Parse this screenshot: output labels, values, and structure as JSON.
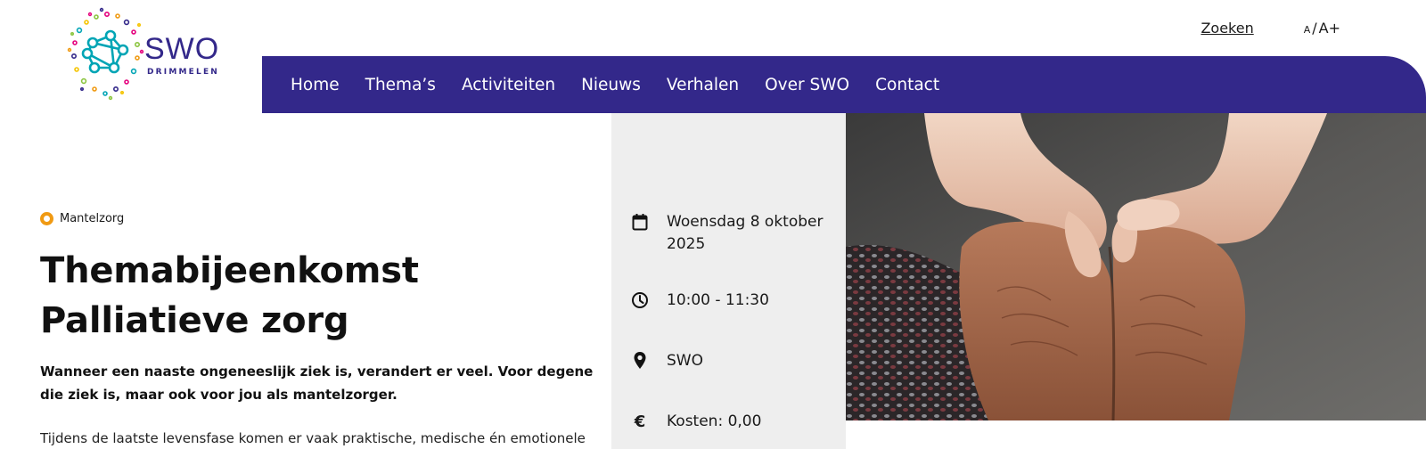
{
  "brand": {
    "name": "SWO",
    "subtitle": "DRIMMELEN",
    "color": "#33288a"
  },
  "top_links": {
    "search": "Zoeken",
    "font_small": "A",
    "font_sep": "/",
    "font_large": "A+"
  },
  "nav": {
    "background": "#33288a",
    "items": [
      "Home",
      "Thema’s",
      "Activiteiten",
      "Nieuws",
      "Verhalen",
      "Over SWO",
      "Contact"
    ]
  },
  "article": {
    "category": "Mantelzorg",
    "category_color": "#f09a13",
    "title": "Themabijeenkomst Palliatieve zorg",
    "intro": "Wanneer een naaste ongeneeslijk ziek is, verandert er veel. Voor degene die ziek is, maar ook voor jou als mantelzorger.",
    "body": "Tijdens de laatste levensfase komen er vaak praktische, medische én emotionele"
  },
  "event_info": {
    "date": {
      "icon": "calendar-icon",
      "text": "Woensdag 8 oktober 2025"
    },
    "time": {
      "icon": "clock-icon",
      "text": "10:00 - 11:30"
    },
    "location": {
      "icon": "map-pin-icon",
      "text": "SWO"
    },
    "cost": {
      "icon": "euro-icon",
      "symbol": "€",
      "text": "Kosten: 0,00"
    }
  },
  "image": {
    "subject": "hands-holding-photo"
  }
}
